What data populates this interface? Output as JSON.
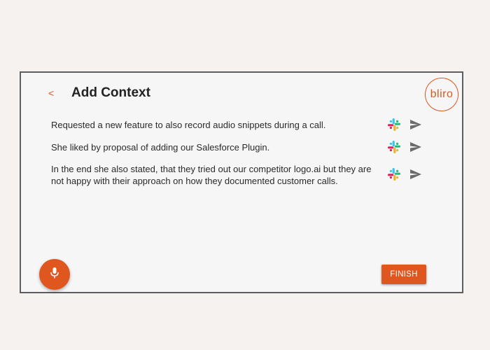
{
  "header": {
    "back_label": "<",
    "title": "Add Context"
  },
  "logo": {
    "text": "bliro"
  },
  "notes": [
    {
      "text": "Requested a new feature to also record audio snippets during a call."
    },
    {
      "text": "She liked by proposal of adding our Salesforce Plugin."
    },
    {
      "text": "In the end she also stated, that they tried out our competitor logo.ai but they are not happy with their approach on how they documented customer calls."
    }
  ],
  "icons": {
    "share": "slack-icon",
    "send": "send-icon",
    "mic": "microphone-icon"
  },
  "footer": {
    "finish_label": "FINISH"
  },
  "colors": {
    "accent": "#e0561f",
    "window_bg": "#f6f6f6",
    "page_bg": "#f5f2ef",
    "send_icon": "#6b6b6b"
  }
}
